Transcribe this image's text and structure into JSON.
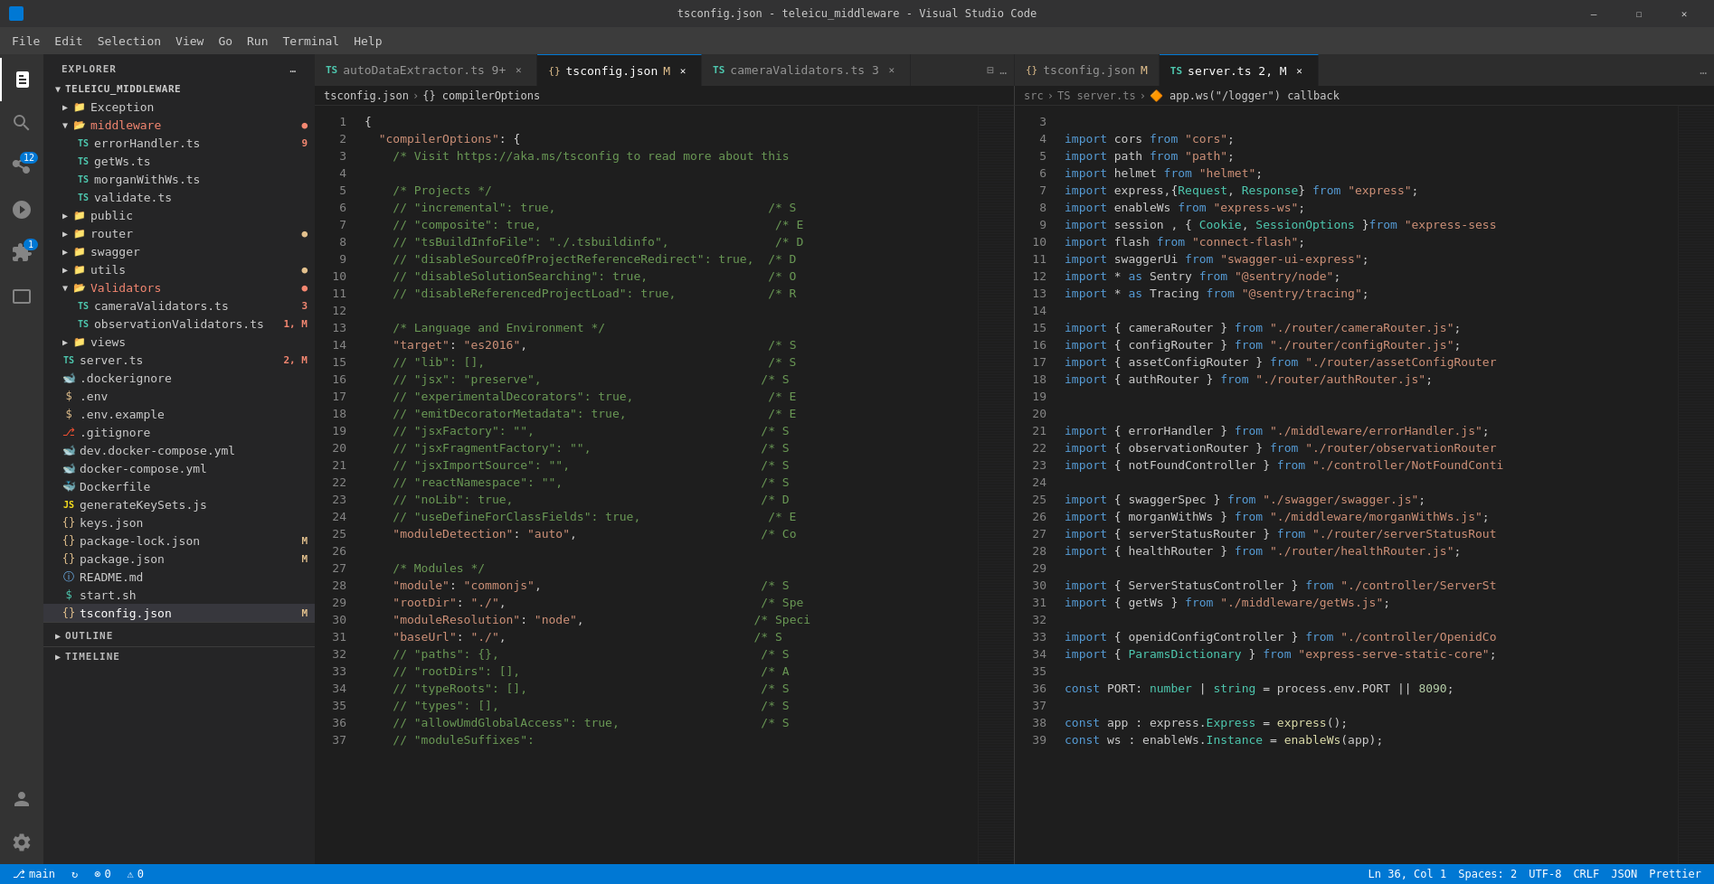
{
  "titleBar": {
    "title": "tsconfig.json - teleicu_middleware - Visual Studio Code",
    "buttons": [
      "minimize",
      "maximize",
      "close"
    ]
  },
  "menuBar": {
    "items": [
      "File",
      "Edit",
      "Selection",
      "View",
      "Go",
      "Run",
      "Terminal",
      "Help"
    ]
  },
  "activityBar": {
    "icons": [
      {
        "name": "explorer",
        "active": true
      },
      {
        "name": "search"
      },
      {
        "name": "source-control",
        "badge": "12"
      },
      {
        "name": "run-debug"
      },
      {
        "name": "extensions",
        "badge": "1"
      },
      {
        "name": "remote-explorer"
      },
      {
        "name": "accounts"
      },
      {
        "name": "settings"
      }
    ]
  },
  "sidebar": {
    "title": "EXPLORER",
    "rootFolder": "TELEICU_MIDDLEWARE",
    "tree": [
      {
        "type": "folder",
        "name": "Exception",
        "level": 1,
        "collapsed": true
      },
      {
        "type": "folder",
        "name": "middleware",
        "level": 1,
        "collapsed": false,
        "color": "red"
      },
      {
        "type": "file",
        "name": "errorHandler.ts",
        "level": 2,
        "ext": "ts",
        "badge": "9",
        "badgeColor": "red"
      },
      {
        "type": "file",
        "name": "getWs.ts",
        "level": 2,
        "ext": "ts"
      },
      {
        "type": "file",
        "name": "morganWithWs.ts",
        "level": 2,
        "ext": "ts"
      },
      {
        "type": "file",
        "name": "validate.ts",
        "level": 2,
        "ext": "ts"
      },
      {
        "type": "folder",
        "name": "public",
        "level": 1,
        "collapsed": true
      },
      {
        "type": "folder",
        "name": "router",
        "level": 1,
        "collapsed": true,
        "dot": "yellow"
      },
      {
        "type": "folder",
        "name": "swagger",
        "level": 1,
        "collapsed": true
      },
      {
        "type": "folder",
        "name": "utils",
        "level": 1,
        "collapsed": true,
        "dot": "yellow"
      },
      {
        "type": "folder",
        "name": "Validators",
        "level": 1,
        "collapsed": false,
        "color": "red"
      },
      {
        "type": "file",
        "name": "cameraValidators.ts",
        "level": 2,
        "ext": "ts",
        "badge": "3",
        "badgeColor": "red"
      },
      {
        "type": "file",
        "name": "observationValidators.ts",
        "level": 2,
        "ext": "ts",
        "badge": "1, M",
        "badgeColor": "red"
      },
      {
        "type": "folder",
        "name": "views",
        "level": 1,
        "collapsed": true
      },
      {
        "type": "file",
        "name": "server.ts",
        "level": 1,
        "ext": "ts",
        "badge": "2, M",
        "badgeColor": "red"
      },
      {
        "type": "file",
        "name": ".dockerignore",
        "level": 1,
        "ext": "docker"
      },
      {
        "type": "file",
        "name": ".env",
        "level": 1,
        "ext": "env"
      },
      {
        "type": "file",
        "name": ".env.example",
        "level": 1,
        "ext": "env"
      },
      {
        "type": "file",
        "name": ".gitignore",
        "level": 1,
        "ext": "git"
      },
      {
        "type": "file",
        "name": "dev.docker-compose.yml",
        "level": 1,
        "ext": "yml"
      },
      {
        "type": "file",
        "name": "docker-compose.yml",
        "level": 1,
        "ext": "yml"
      },
      {
        "type": "file",
        "name": "Dockerfile",
        "level": 1,
        "ext": "docker"
      },
      {
        "type": "file",
        "name": "generateKeySets.js",
        "level": 1,
        "ext": "js"
      },
      {
        "type": "file",
        "name": "keys.json",
        "level": 1,
        "ext": "json"
      },
      {
        "type": "file",
        "name": "package-lock.json",
        "level": 1,
        "ext": "json",
        "badge": "M",
        "badgeColor": "yellow"
      },
      {
        "type": "file",
        "name": "package.json",
        "level": 1,
        "ext": "json",
        "badge": "M",
        "badgeColor": "yellow"
      },
      {
        "type": "file",
        "name": "README.md",
        "level": 1,
        "ext": "md"
      },
      {
        "type": "file",
        "name": "start.sh",
        "level": 1,
        "ext": "sh"
      },
      {
        "type": "file",
        "name": "tsconfig.json",
        "level": 1,
        "ext": "json",
        "badge": "M",
        "badgeColor": "yellow",
        "active": true
      }
    ],
    "outline": {
      "title": "OUTLINE"
    },
    "timeline": {
      "title": "TIMELINE"
    }
  },
  "tabs": {
    "left": [
      {
        "label": "autoDataExtractor.ts 9+",
        "ext": "ts",
        "active": false,
        "modified": false
      },
      {
        "label": "tsconfig.json",
        "ext": "json",
        "active": true,
        "modified": true
      },
      {
        "label": "cameraValidators.ts 3",
        "ext": "ts",
        "active": false,
        "modified": false
      }
    ],
    "right": [
      {
        "label": "tsconfig.json",
        "ext": "json",
        "active": false,
        "modified": true
      },
      {
        "label": "server.ts 2, M",
        "ext": "ts",
        "active": true,
        "modified": true
      }
    ]
  },
  "breadcrumbs": {
    "left": [
      "tsconfig.json",
      "{} compilerOptions"
    ],
    "right": [
      "src",
      "server.ts",
      "app.ws(\"/logger\") callback"
    ]
  },
  "leftEditor": {
    "lines": [
      {
        "n": 1,
        "code": "{"
      },
      {
        "n": 2,
        "code": "  \"compilerOptions\": {"
      },
      {
        "n": 3,
        "code": "    /* Visit https://aka.ms/tsconfig to read more about this"
      },
      {
        "n": 4,
        "code": ""
      },
      {
        "n": 5,
        "code": "    /* Projects */"
      },
      {
        "n": 6,
        "code": "    // \"incremental\": true,                              /* S"
      },
      {
        "n": 7,
        "code": "    // \"composite\": true,                                 /* E"
      },
      {
        "n": 8,
        "code": "    // \"tsBuildInfoFile\": \"./.tsbuildinfo\",               /* D"
      },
      {
        "n": 9,
        "code": "    // \"disableSourceOfProjectReferenceRedirect\": true,  /* D"
      },
      {
        "n": 10,
        "code": "    // \"disableSolutionSearching\": true,                 /* O"
      },
      {
        "n": 11,
        "code": "    // \"disableReferencedProjectLoad\": true,             /* R"
      },
      {
        "n": 12,
        "code": ""
      },
      {
        "n": 13,
        "code": "    /* Language and Environment */"
      },
      {
        "n": 14,
        "code": "    \"target\": \"es2016\",                                  /* S"
      },
      {
        "n": 15,
        "code": "    // \"lib\": [],                                        /* S"
      },
      {
        "n": 16,
        "code": "    // \"jsx\": \"preserve\",                               /* S"
      },
      {
        "n": 17,
        "code": "    // \"experimentalDecorators\": true,                   /* E"
      },
      {
        "n": 18,
        "code": "    // \"emitDecoratorMetadata\": true,                    /* E"
      },
      {
        "n": 19,
        "code": "    // \"jsxFactory\": \"\",                                /* S"
      },
      {
        "n": 20,
        "code": "    // \"jsxFragmentFactory\": \"\",                        /* S"
      },
      {
        "n": 21,
        "code": "    // \"jsxImportSource\": \"\",                           /* S"
      },
      {
        "n": 22,
        "code": "    // \"reactNamespace\": \"\",                            /* S"
      },
      {
        "n": 23,
        "code": "    // \"noLib\": true,                                   /* D"
      },
      {
        "n": 24,
        "code": "    // \"useDefineForClassFields\": true,                  /* E"
      },
      {
        "n": 25,
        "code": "    \"moduleDetection\": \"auto\",                          /* Co"
      },
      {
        "n": 26,
        "code": ""
      },
      {
        "n": 27,
        "code": "    /* Modules */"
      },
      {
        "n": 28,
        "code": "    \"module\": \"commonjs\",                               /* S"
      },
      {
        "n": 29,
        "code": "    \"rootDir\": \"./\",                                    /* Spe"
      },
      {
        "n": 30,
        "code": "    \"moduleResolution\": \"node\",                        /* Speci"
      },
      {
        "n": 31,
        "code": "    \"baseUrl\": \"./\",                                   /* S"
      },
      {
        "n": 32,
        "code": "    // \"paths\": {},                                     /* S"
      },
      {
        "n": 33,
        "code": "    // \"rootDirs\": [],                                  /* A"
      },
      {
        "n": 34,
        "code": "    // \"typeRoots\": [],                                 /* S"
      },
      {
        "n": 35,
        "code": "    // \"types\": [],                                     /* S"
      },
      {
        "n": 36,
        "code": "    // \"allowUmdGlobalAccess\": true,                    /* S"
      },
      {
        "n": 37,
        "code": "    // \"moduleSuffixes\":"
      }
    ]
  },
  "rightEditor": {
    "lines": [
      {
        "n": 3,
        "code": ""
      },
      {
        "n": 4,
        "code": "import cors from \"cors\";"
      },
      {
        "n": 5,
        "code": "import path from \"path\";"
      },
      {
        "n": 6,
        "code": "import helmet from \"helmet\";"
      },
      {
        "n": 7,
        "code": "import express,{Request, Response} from \"express\";"
      },
      {
        "n": 8,
        "code": "import enableWs from \"express-ws\";"
      },
      {
        "n": 9,
        "code": "import session , { Cookie, SessionOptions }from \"express-sess"
      },
      {
        "n": 10,
        "code": "import flash from \"connect-flash\";"
      },
      {
        "n": 11,
        "code": "import swaggerUi from \"swagger-ui-express\";"
      },
      {
        "n": 12,
        "code": "import * as Sentry from \"@sentry/node\";"
      },
      {
        "n": 13,
        "code": "import * as Tracing from \"@sentry/tracing\";"
      },
      {
        "n": 14,
        "code": ""
      },
      {
        "n": 15,
        "code": "import { cameraRouter } from \"./router/cameraRouter.js\";"
      },
      {
        "n": 16,
        "code": "import { configRouter } from \"./router/configRouter.js\";"
      },
      {
        "n": 17,
        "code": "import { assetConfigRouter } from \"./router/assetConfigRouter"
      },
      {
        "n": 18,
        "code": "import { authRouter } from \"./router/authRouter.js\";"
      },
      {
        "n": 19,
        "code": ""
      },
      {
        "n": 20,
        "code": ""
      },
      {
        "n": 21,
        "code": "import { errorHandler } from \"./middleware/errorHandler.js\";"
      },
      {
        "n": 22,
        "code": "import { observationRouter } from \"./router/observationRouter"
      },
      {
        "n": 23,
        "code": "import { notFoundController } from \"./controller/NotFoundConti"
      },
      {
        "n": 24,
        "code": ""
      },
      {
        "n": 25,
        "code": "import { swaggerSpec } from \"./swagger/swagger.js\";"
      },
      {
        "n": 26,
        "code": "import { morganWithWs } from \"./middleware/morganWithWs.js\";"
      },
      {
        "n": 27,
        "code": "import { serverStatusRouter } from \"./router/serverStatusRout"
      },
      {
        "n": 28,
        "code": "import { healthRouter } from \"./router/healthRouter.js\";"
      },
      {
        "n": 29,
        "code": ""
      },
      {
        "n": 30,
        "code": "import { ServerStatusController } from \"./controller/ServerSt"
      },
      {
        "n": 31,
        "code": "import { getWs } from \"./middleware/getWs.js\";"
      },
      {
        "n": 32,
        "code": ""
      },
      {
        "n": 33,
        "code": "import { openidConfigController } from \"./controller/OpenidCo"
      },
      {
        "n": 34,
        "code": "import { ParamsDictionary } from \"express-serve-static-core\";"
      },
      {
        "n": 35,
        "code": ""
      },
      {
        "n": 36,
        "code": "const PORT: number | string = process.env.PORT || 8090;"
      },
      {
        "n": 37,
        "code": ""
      },
      {
        "n": 38,
        "code": "const app : express.Express = express();"
      },
      {
        "n": 39,
        "code": "const ws : enableWs.Instance = enableWs(app);"
      }
    ]
  },
  "statusBar": {
    "left": [
      {
        "icon": "branch",
        "text": "main"
      },
      {
        "icon": "sync",
        "text": ""
      },
      {
        "icon": "error",
        "text": "0"
      },
      {
        "icon": "warning",
        "text": "0"
      }
    ],
    "right": [
      {
        "text": "Ln 36, Col 1"
      },
      {
        "text": "Spaces: 2"
      },
      {
        "text": "UTF-8"
      },
      {
        "text": "CRLF"
      },
      {
        "text": "JSON"
      },
      {
        "text": "Prettier"
      },
      {
        "text": ""
      }
    ]
  }
}
